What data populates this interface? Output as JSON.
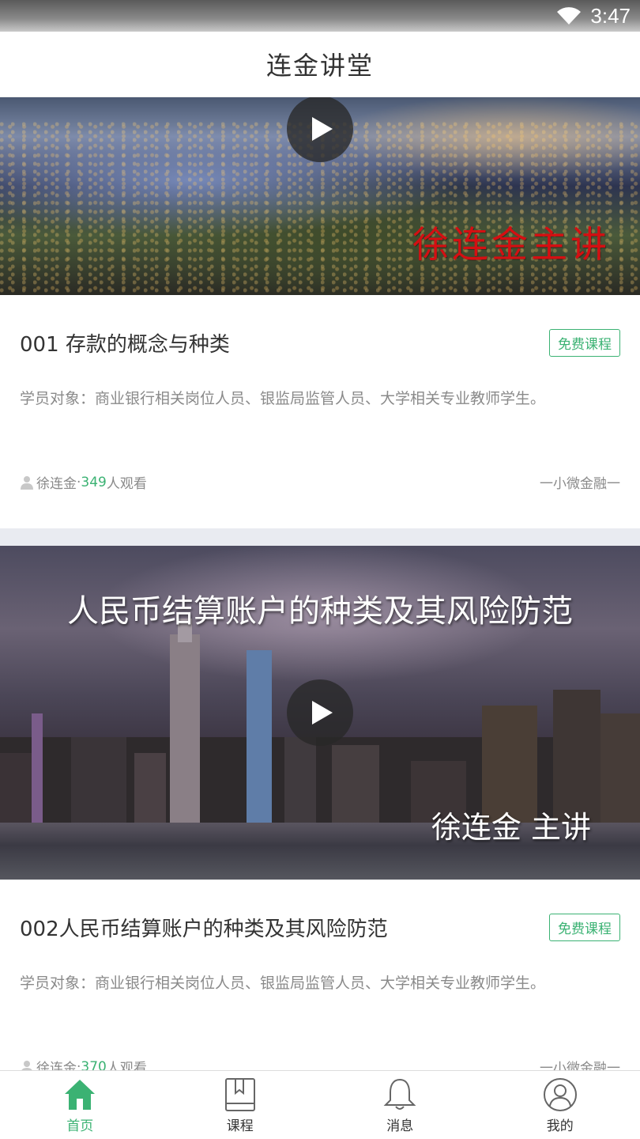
{
  "status_bar": {
    "time": "3:47"
  },
  "header": {
    "title": "连金讲堂"
  },
  "courses": [
    {
      "cover_overlay": "徐连金主讲",
      "title": "001 存款的概念与种类",
      "tag": "免费课程",
      "description": "学员对象：商业银行相关岗位人员、银监局监管人员、大学相关专业教师学生。",
      "author": "徐连金",
      "separator": " · ",
      "views": "349",
      "views_suffix": "人观看",
      "source": "一小微金融一"
    },
    {
      "cover_title": "人民币结算账户的种类及其风险防范",
      "cover_speaker": "徐连金 主讲",
      "title": "002人民币结算账户的种类及其风险防范",
      "tag": "免费课程",
      "description": "学员对象：商业银行相关岗位人员、银监局监管人员、大学相关专业教师学生。",
      "author": "徐连金",
      "separator": " · ",
      "views": "370",
      "views_suffix": "人观看",
      "source": "一小微金融一"
    }
  ],
  "bottom_nav": [
    {
      "label": "首页",
      "icon": "home-icon",
      "active": true
    },
    {
      "label": "课程",
      "icon": "book-icon",
      "active": false
    },
    {
      "label": "消息",
      "icon": "bell-icon",
      "active": false
    },
    {
      "label": "我的",
      "icon": "profile-icon",
      "active": false
    }
  ],
  "colors": {
    "accent": "#3bb273",
    "overlay_red": "#d40f12",
    "feed_background": "#e9ebf1"
  }
}
